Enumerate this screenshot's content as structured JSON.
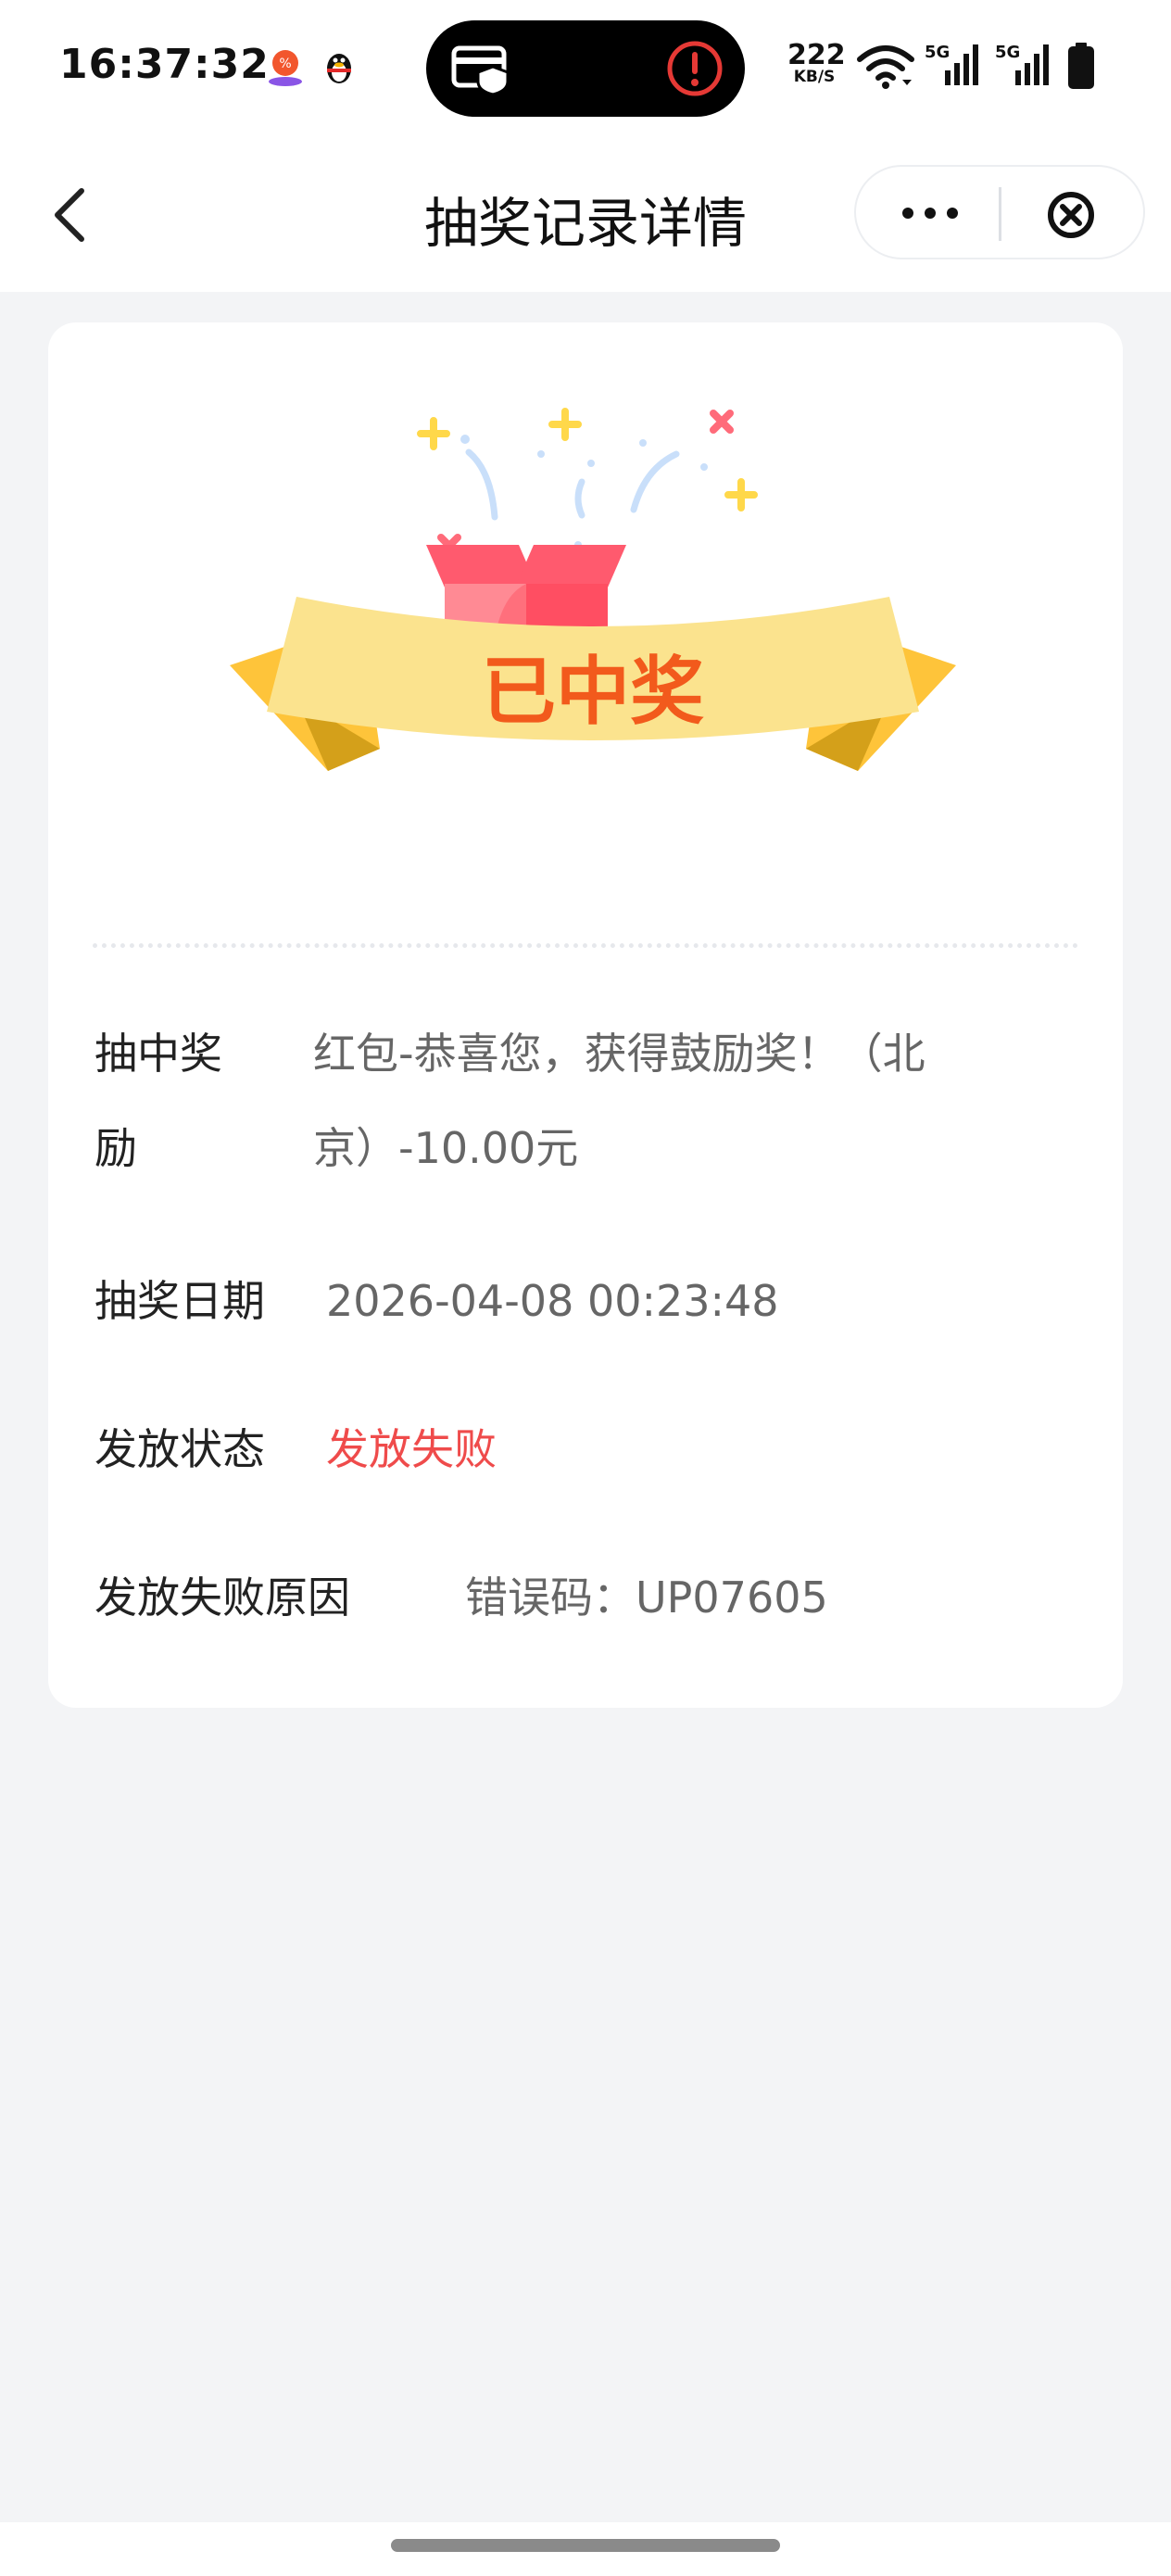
{
  "status_bar": {
    "time": "16:37:32",
    "net_speed_value": "222",
    "net_speed_unit": "KB/S",
    "icons": [
      "shopping-app-icon",
      "qq-penguin-icon",
      "card-shield-icon",
      "alert-icon",
      "wifi-icon",
      "signal-5g-icon",
      "signal-5g-icon",
      "battery-icon"
    ]
  },
  "nav": {
    "title": "抽奖记录详情",
    "back_icon": "chevron-left-icon",
    "more_icon": "more-dots-icon",
    "close_icon": "close-circle-icon"
  },
  "card": {
    "banner_text": "已中奖",
    "rows": [
      {
        "label": "抽中奖励",
        "value": "红包-恭喜您，获得鼓励奖！（北京）-10.00元"
      },
      {
        "label": "抽奖日期",
        "value": "2026-04-08 00:23:48"
      },
      {
        "label": "发放状态",
        "value": "发放失败"
      },
      {
        "label": "发放失败原因",
        "value": "错误码：UP07605"
      }
    ]
  },
  "colors": {
    "status_fail": "#ef4b4b",
    "banner_text": "#f25a1c",
    "banner_ribbon": "#fbe38e",
    "gift_box": "#ff5a6e"
  }
}
